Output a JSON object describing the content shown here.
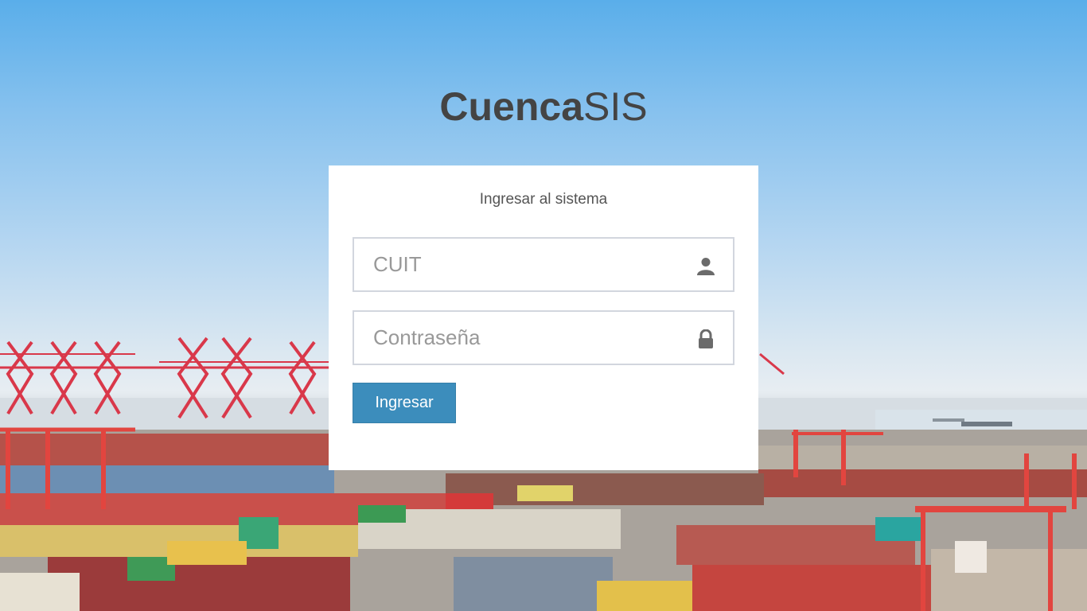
{
  "brand": {
    "bold": "Cuenca",
    "light": "SIS"
  },
  "login": {
    "title": "Ingresar al sistema",
    "cuit_placeholder": "CUIT",
    "cuit_value": "",
    "password_placeholder": "Contraseña",
    "password_value": "",
    "submit_label": "Ingresar"
  },
  "icons": {
    "cuit": "user-icon",
    "password": "lock-icon"
  },
  "colors": {
    "button": "#3c8dbc",
    "brand_text": "#444444"
  }
}
